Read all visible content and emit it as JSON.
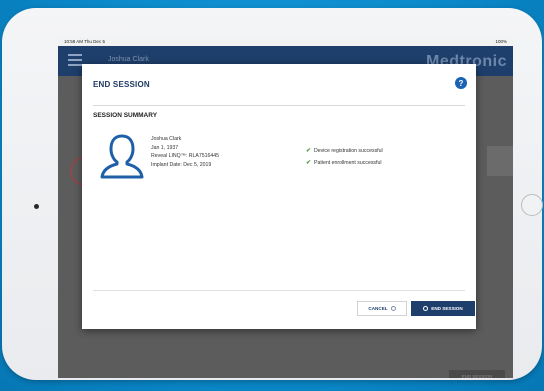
{
  "status_bar": {
    "time": "10:58 AM  Thu Dec 5",
    "battery": "100%"
  },
  "header": {
    "patient_name": "Joshua Clark",
    "brand": "Medtronic"
  },
  "background": {
    "end_session_label": "END SESSION"
  },
  "modal": {
    "title": "END SESSION",
    "help_label": "?",
    "section_title": "SESSION SUMMARY",
    "patient": {
      "name": "Joshua Clark",
      "dob": "Jan 1, 1937",
      "device": "Reveal LINQ™: RLA7516445",
      "implant_date": "Implant Date: Dec 5, 2019"
    },
    "results": [
      "Device registration successful",
      "Patient enrollment successful"
    ],
    "buttons": {
      "cancel": "CANCEL",
      "end_session": "END SESSION"
    }
  },
  "colors": {
    "brand_navy": "#1e3f6b",
    "success_green": "#4f9a3c",
    "help_blue": "#1a62b3",
    "background_blue": "#0b8fd1"
  },
  "icons": {
    "menu": "menu-icon",
    "help": "help-icon",
    "avatar": "user-outline-icon",
    "check": "checkmark-icon",
    "cancel": "circle-x-icon",
    "end": "circle-icon"
  }
}
